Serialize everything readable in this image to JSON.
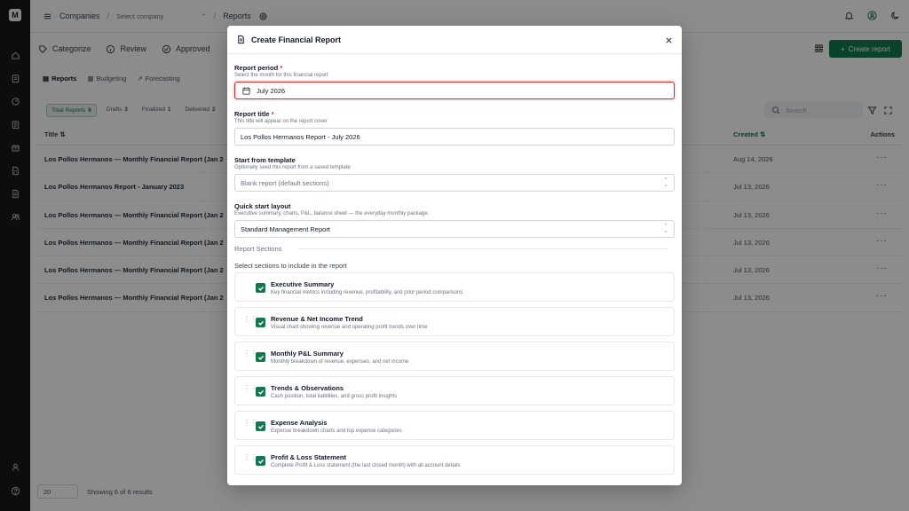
{
  "rail": {
    "logo": "M",
    "icons": [
      "home-icon",
      "clipboard-icon",
      "gauge-icon",
      "ledger-icon",
      "archive-icon",
      "file-icon",
      "document-icon",
      "users-icon",
      "user-icon",
      "help-icon"
    ]
  },
  "topbar": {
    "companies": "Companies",
    "select_company": "Select company",
    "reports": "Reports"
  },
  "main_tabs": [
    {
      "label": "Categorize"
    },
    {
      "label": "Review"
    },
    {
      "label": "Approved"
    }
  ],
  "create_report_label": "Create report",
  "sub_tabs": [
    {
      "label": "Reports"
    },
    {
      "label": "Budgeting"
    },
    {
      "label": "Forecasting"
    }
  ],
  "filters": [
    {
      "label": "Total Reports",
      "count": "6"
    },
    {
      "label": "Drafts",
      "count": "3"
    },
    {
      "label": "Finalized",
      "count": "1"
    },
    {
      "label": "Delivered",
      "count": "2"
    }
  ],
  "search_placeholder": "Search",
  "table": {
    "col_title": "Title",
    "col_created": "Created",
    "col_actions": "Actions",
    "rows": [
      {
        "title": "Los Pollos Hermanos — Monthly Financial Report (Jan 2",
        "created": "Aug 14, 2026"
      },
      {
        "title": "Los Pollos Hermanos Report - January 2023",
        "created": "Jul 13, 2026"
      },
      {
        "title": "Los Pollos Hermanos — Monthly Financial Report (Jan 2",
        "created": "Jul 13, 2026"
      },
      {
        "title": "Los Pollos Hermanos — Monthly Financial Report (Jan 2",
        "created": "Jul 13, 2026"
      },
      {
        "title": "Los Pollos Hermanos — Monthly Financial Report (Jan 2",
        "created": "Jul 13, 2026"
      },
      {
        "title": "Los Pollos Hermanos — Monthly Financial Report (Jan 2",
        "created": "Jul 13, 2026"
      }
    ]
  },
  "footer": {
    "page_size": "20",
    "showing": "Showing 6 of 6 results"
  },
  "modal": {
    "title": "Create Financial Report",
    "period": {
      "label": "Report period",
      "help": "Select the month for this financial report",
      "value": "July 2026"
    },
    "report_title": {
      "label": "Report title",
      "help": "This title will appear on the report cover",
      "value": "Los Pollos Hermanos Report - July 2026"
    },
    "template": {
      "label": "Start from template",
      "help": "Optionally seed this report from a saved template",
      "placeholder": "Blank report (default sections)"
    },
    "layout": {
      "label": "Quick start layout",
      "help": "Executive summary, charts, P&L, balance sheet — the everyday monthly package.",
      "value": "Standard Management Report"
    },
    "sections_heading": "Report Sections",
    "sections_sub": "Select sections to include in the report",
    "sections": [
      {
        "title": "Executive Summary",
        "desc": "Key financial metrics including revenue, profitability, and prior period comparisons",
        "checked": true
      },
      {
        "title": "Revenue & Net Income Trend",
        "desc": "Visual chart showing revenue and operating profit trends over time",
        "checked": true
      },
      {
        "title": "Monthly P&L Summary",
        "desc": "Monthly breakdown of revenue, expenses, and net income",
        "checked": true
      },
      {
        "title": "Trends & Observations",
        "desc": "Cash position, total liabilities, and gross profit insights",
        "checked": true
      },
      {
        "title": "Expense Analysis",
        "desc": "Expense breakdown charts and top expense categories",
        "checked": true
      },
      {
        "title": "Profit & Loss Statement",
        "desc": "Complete Profit & Loss statement (the last closed month) with all account details",
        "checked": true
      }
    ]
  },
  "colors": {
    "accent": "#13784f",
    "focus_ring": "#dc2626",
    "rail": "#181818"
  }
}
